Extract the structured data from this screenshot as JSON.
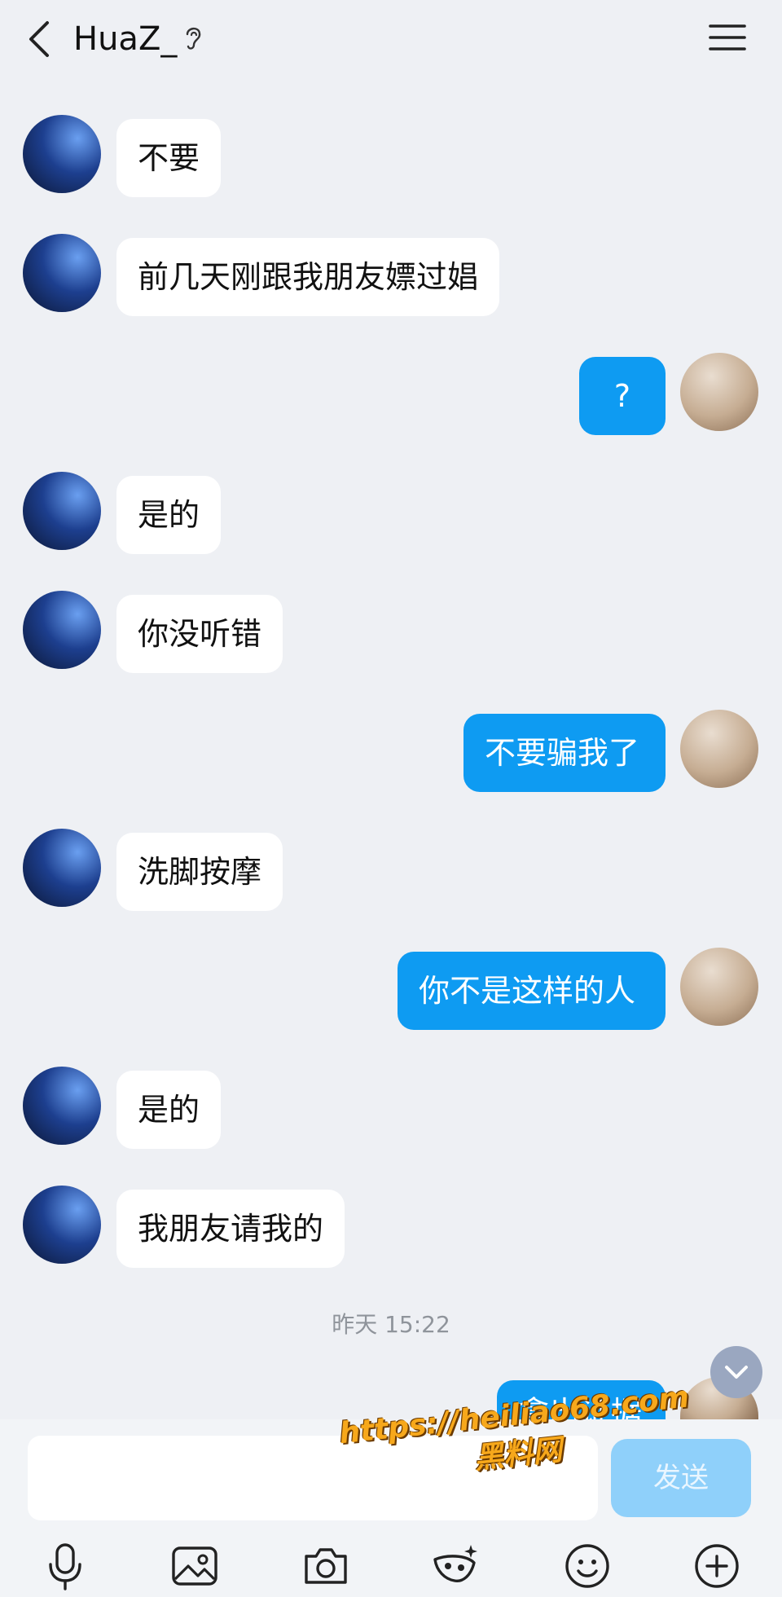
{
  "header": {
    "title": "HuaZ_"
  },
  "messages": [
    {
      "side": "left",
      "text": "不要"
    },
    {
      "side": "left",
      "text": "前几天刚跟我朋友嫖过娼"
    },
    {
      "side": "right",
      "text": "?"
    },
    {
      "side": "left",
      "text": "是的"
    },
    {
      "side": "left",
      "text": "你没听错"
    },
    {
      "side": "right",
      "text": "不要骗我了"
    },
    {
      "side": "left",
      "text": "洗脚按摩"
    },
    {
      "side": "right",
      "text": "你不是这样的人"
    },
    {
      "side": "left",
      "text": "是的"
    },
    {
      "side": "left",
      "text": "我朋友请我的"
    },
    {
      "side": "right",
      "text": "拿出证据"
    }
  ],
  "timestamp": "昨天 15:22",
  "composer": {
    "send_label": "发送"
  },
  "watermark": {
    "url": "https://heiliao68.com",
    "name": "黑料网"
  },
  "colors": {
    "accent": "#0e9bf2",
    "send_disabled": "#8fd0fa",
    "background": "#eef0f4"
  }
}
